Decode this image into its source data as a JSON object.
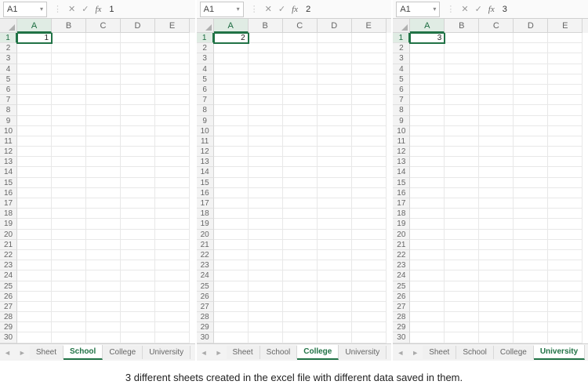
{
  "columns": [
    "A",
    "B",
    "C",
    "D",
    "E"
  ],
  "row_count": 30,
  "workbooks": [
    {
      "namebox": "A1",
      "formula_value": "1",
      "cell_a1": "1",
      "active_cell_col": 0,
      "active_cell_row": 0,
      "tabs": [
        "Sheet",
        "School",
        "College",
        "University"
      ],
      "active_tab_index": 1
    },
    {
      "namebox": "A1",
      "formula_value": "2",
      "cell_a1": "2",
      "active_cell_col": 0,
      "active_cell_row": 0,
      "tabs": [
        "Sheet",
        "School",
        "College",
        "University"
      ],
      "active_tab_index": 2
    },
    {
      "namebox": "A1",
      "formula_value": "3",
      "cell_a1": "3",
      "active_cell_col": 0,
      "active_cell_row": 0,
      "tabs": [
        "Sheet",
        "School",
        "College",
        "University"
      ],
      "active_tab_index": 3
    }
  ],
  "caption": "3 different sheets created in the excel file with different data saved in them."
}
